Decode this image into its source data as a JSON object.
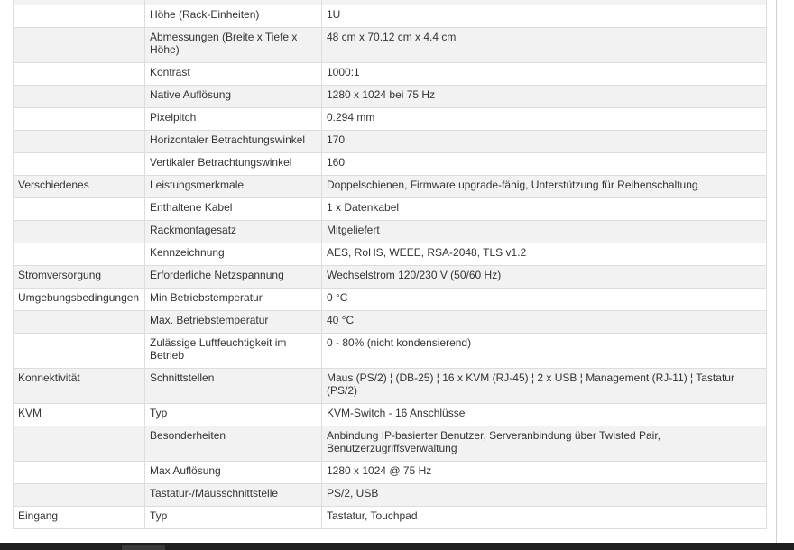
{
  "spec_table": {
    "rows": [
      {
        "group": "",
        "attribute": "",
        "value": ""
      },
      {
        "group": "",
        "attribute": "Höhe (Rack-Einheiten)",
        "value": "1U"
      },
      {
        "group": "",
        "attribute": "Abmessungen (Breite x Tiefe x Höhe)",
        "value": "48 cm x 70.12 cm x 4.4 cm"
      },
      {
        "group": "",
        "attribute": "Kontrast",
        "value": "1000:1"
      },
      {
        "group": "",
        "attribute": "Native Auflösung",
        "value": "1280 x 1024 bei 75 Hz"
      },
      {
        "group": "",
        "attribute": "Pixelpitch",
        "value": "0.294 mm"
      },
      {
        "group": "",
        "attribute": "Horizontaler Betrachtungswinkel",
        "value": "170"
      },
      {
        "group": "",
        "attribute": "Vertikaler Betrachtungswinkel",
        "value": "160"
      },
      {
        "group": "Verschiedenes",
        "attribute": "Leistungsmerkmale",
        "value": "Doppelschienen, Firmware upgrade-fähig, Unterstützung für Reihenschaltung"
      },
      {
        "group": "",
        "attribute": "Enthaltene Kabel",
        "value": "1 x Datenkabel"
      },
      {
        "group": "",
        "attribute": "Rackmontagesatz",
        "value": "Mitgeliefert"
      },
      {
        "group": "",
        "attribute": "Kennzeichnung",
        "value": "AES, RoHS, WEEE, RSA-2048, TLS v1.2"
      },
      {
        "group": "Stromversorgung",
        "attribute": "Erforderliche Netzspannung",
        "value": "Wechselstrom 120/230 V (50/60 Hz)"
      },
      {
        "group": "Umgebungsbedingungen",
        "attribute": "Min Betriebstemperatur",
        "value": "0 °C"
      },
      {
        "group": "",
        "attribute": "Max. Betriebstemperatur",
        "value": "40 °C"
      },
      {
        "group": "",
        "attribute": "Zulässige Luftfeuchtigkeit im Betrieb",
        "value": "0 - 80% (nicht kondensierend)"
      },
      {
        "group": "Konnektivität",
        "attribute": "Schnittstellen",
        "value": "Maus (PS/2) ¦ (DB-25) ¦ 16 x KVM (RJ-45) ¦ 2 x USB ¦ Management (RJ-11) ¦ Tastatur (PS/2)"
      },
      {
        "group": "KVM",
        "attribute": "Typ",
        "value": "KVM-Switch - 16 Anschlüsse"
      },
      {
        "group": "",
        "attribute": "Besonderheiten",
        "value": "Anbindung IP-basierter Benutzer, Serveranbindung über Twisted Pair, Benutzerzugriffsverwaltung"
      },
      {
        "group": "",
        "attribute": "Max Auflösung",
        "value": "1280 x 1024 @ 75 Hz"
      },
      {
        "group": "",
        "attribute": "Tastatur-/Mausschnittstelle",
        "value": "PS/2, USB"
      },
      {
        "group": "Eingang",
        "attribute": "Typ",
        "value": "Tastatur, Touchpad"
      }
    ]
  }
}
